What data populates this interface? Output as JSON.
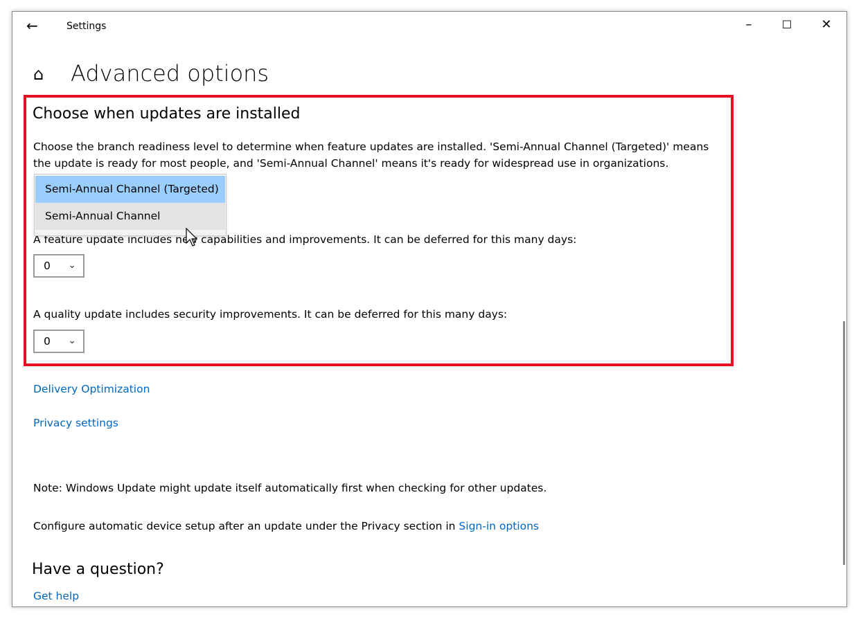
{
  "window": {
    "title": "Settings",
    "back_icon": "arrow-left-icon",
    "controls": [
      "minimize-icon",
      "maximize-icon",
      "close-icon"
    ]
  },
  "page": {
    "title": "Advanced options",
    "home_icon": "home-icon"
  },
  "section": {
    "heading": "Choose when updates are installed",
    "description": "Choose the branch readiness level to determine when feature updates are installed. 'Semi-Annual Channel (Targeted)' means the update is ready for most people, and 'Semi-Annual Channel' means it's ready for widespread use in organizations.",
    "branch_options": [
      "Semi-Annual Channel (Targeted)",
      "Semi-Annual Channel"
    ],
    "feature_label": "A feature update includes new capabilities and improvements. It can be deferred for this many days:",
    "feature_value": "0",
    "quality_label": "A quality update includes security improvements. It can be deferred for this many days:",
    "quality_value": "0",
    "highlight_color": "#e81123"
  },
  "links": {
    "delivery": "Delivery Optimization",
    "privacy": "Privacy settings"
  },
  "note": "Note: Windows Update might update itself automatically first when checking for other updates.",
  "configure": {
    "text": "Configure automatic device setup after an update under the Privacy section in ",
    "link": "Sign-in options"
  },
  "question": {
    "heading": "Have a question?",
    "link": "Get help"
  },
  "accent_color": "#0067c0"
}
